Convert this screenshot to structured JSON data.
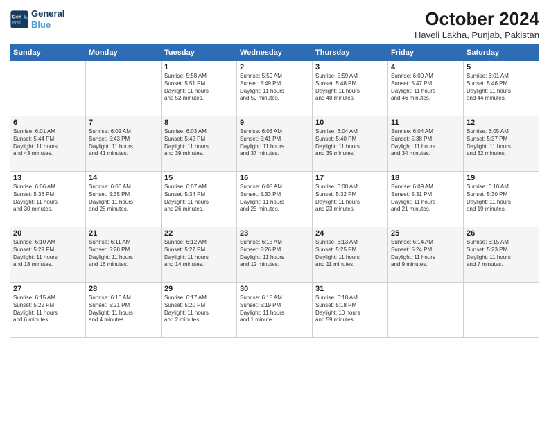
{
  "header": {
    "logo_line1": "General",
    "logo_line2": "Blue",
    "month": "October 2024",
    "location": "Haveli Lakha, Punjab, Pakistan"
  },
  "weekdays": [
    "Sunday",
    "Monday",
    "Tuesday",
    "Wednesday",
    "Thursday",
    "Friday",
    "Saturday"
  ],
  "weeks": [
    [
      {
        "day": "",
        "info": ""
      },
      {
        "day": "",
        "info": ""
      },
      {
        "day": "1",
        "info": "Sunrise: 5:58 AM\nSunset: 5:51 PM\nDaylight: 11 hours\nand 52 minutes."
      },
      {
        "day": "2",
        "info": "Sunrise: 5:59 AM\nSunset: 5:49 PM\nDaylight: 11 hours\nand 50 minutes."
      },
      {
        "day": "3",
        "info": "Sunrise: 5:59 AM\nSunset: 5:48 PM\nDaylight: 11 hours\nand 48 minutes."
      },
      {
        "day": "4",
        "info": "Sunrise: 6:00 AM\nSunset: 5:47 PM\nDaylight: 11 hours\nand 46 minutes."
      },
      {
        "day": "5",
        "info": "Sunrise: 6:01 AM\nSunset: 5:46 PM\nDaylight: 11 hours\nand 44 minutes."
      }
    ],
    [
      {
        "day": "6",
        "info": "Sunrise: 6:01 AM\nSunset: 5:44 PM\nDaylight: 11 hours\nand 43 minutes."
      },
      {
        "day": "7",
        "info": "Sunrise: 6:02 AM\nSunset: 5:43 PM\nDaylight: 11 hours\nand 41 minutes."
      },
      {
        "day": "8",
        "info": "Sunrise: 6:03 AM\nSunset: 5:42 PM\nDaylight: 11 hours\nand 39 minutes."
      },
      {
        "day": "9",
        "info": "Sunrise: 6:03 AM\nSunset: 5:41 PM\nDaylight: 11 hours\nand 37 minutes."
      },
      {
        "day": "10",
        "info": "Sunrise: 6:04 AM\nSunset: 5:40 PM\nDaylight: 11 hours\nand 35 minutes."
      },
      {
        "day": "11",
        "info": "Sunrise: 6:04 AM\nSunset: 5:38 PM\nDaylight: 11 hours\nand 34 minutes."
      },
      {
        "day": "12",
        "info": "Sunrise: 6:05 AM\nSunset: 5:37 PM\nDaylight: 11 hours\nand 32 minutes."
      }
    ],
    [
      {
        "day": "13",
        "info": "Sunrise: 6:06 AM\nSunset: 5:36 PM\nDaylight: 11 hours\nand 30 minutes."
      },
      {
        "day": "14",
        "info": "Sunrise: 6:06 AM\nSunset: 5:35 PM\nDaylight: 11 hours\nand 28 minutes."
      },
      {
        "day": "15",
        "info": "Sunrise: 6:07 AM\nSunset: 5:34 PM\nDaylight: 11 hours\nand 26 minutes."
      },
      {
        "day": "16",
        "info": "Sunrise: 6:08 AM\nSunset: 5:33 PM\nDaylight: 11 hours\nand 25 minutes."
      },
      {
        "day": "17",
        "info": "Sunrise: 6:08 AM\nSunset: 5:32 PM\nDaylight: 11 hours\nand 23 minutes."
      },
      {
        "day": "18",
        "info": "Sunrise: 6:09 AM\nSunset: 5:31 PM\nDaylight: 11 hours\nand 21 minutes."
      },
      {
        "day": "19",
        "info": "Sunrise: 6:10 AM\nSunset: 5:30 PM\nDaylight: 11 hours\nand 19 minutes."
      }
    ],
    [
      {
        "day": "20",
        "info": "Sunrise: 6:10 AM\nSunset: 5:29 PM\nDaylight: 11 hours\nand 18 minutes."
      },
      {
        "day": "21",
        "info": "Sunrise: 6:11 AM\nSunset: 5:28 PM\nDaylight: 11 hours\nand 16 minutes."
      },
      {
        "day": "22",
        "info": "Sunrise: 6:12 AM\nSunset: 5:27 PM\nDaylight: 11 hours\nand 14 minutes."
      },
      {
        "day": "23",
        "info": "Sunrise: 6:13 AM\nSunset: 5:26 PM\nDaylight: 11 hours\nand 12 minutes."
      },
      {
        "day": "24",
        "info": "Sunrise: 6:13 AM\nSunset: 5:25 PM\nDaylight: 11 hours\nand 11 minutes."
      },
      {
        "day": "25",
        "info": "Sunrise: 6:14 AM\nSunset: 5:24 PM\nDaylight: 11 hours\nand 9 minutes."
      },
      {
        "day": "26",
        "info": "Sunrise: 6:15 AM\nSunset: 5:23 PM\nDaylight: 11 hours\nand 7 minutes."
      }
    ],
    [
      {
        "day": "27",
        "info": "Sunrise: 6:15 AM\nSunset: 5:22 PM\nDaylight: 11 hours\nand 6 minutes."
      },
      {
        "day": "28",
        "info": "Sunrise: 6:16 AM\nSunset: 5:21 PM\nDaylight: 11 hours\nand 4 minutes."
      },
      {
        "day": "29",
        "info": "Sunrise: 6:17 AM\nSunset: 5:20 PM\nDaylight: 11 hours\nand 2 minutes."
      },
      {
        "day": "30",
        "info": "Sunrise: 6:18 AM\nSunset: 5:19 PM\nDaylight: 11 hours\nand 1 minute."
      },
      {
        "day": "31",
        "info": "Sunrise: 6:18 AM\nSunset: 5:18 PM\nDaylight: 10 hours\nand 59 minutes."
      },
      {
        "day": "",
        "info": ""
      },
      {
        "day": "",
        "info": ""
      }
    ]
  ]
}
